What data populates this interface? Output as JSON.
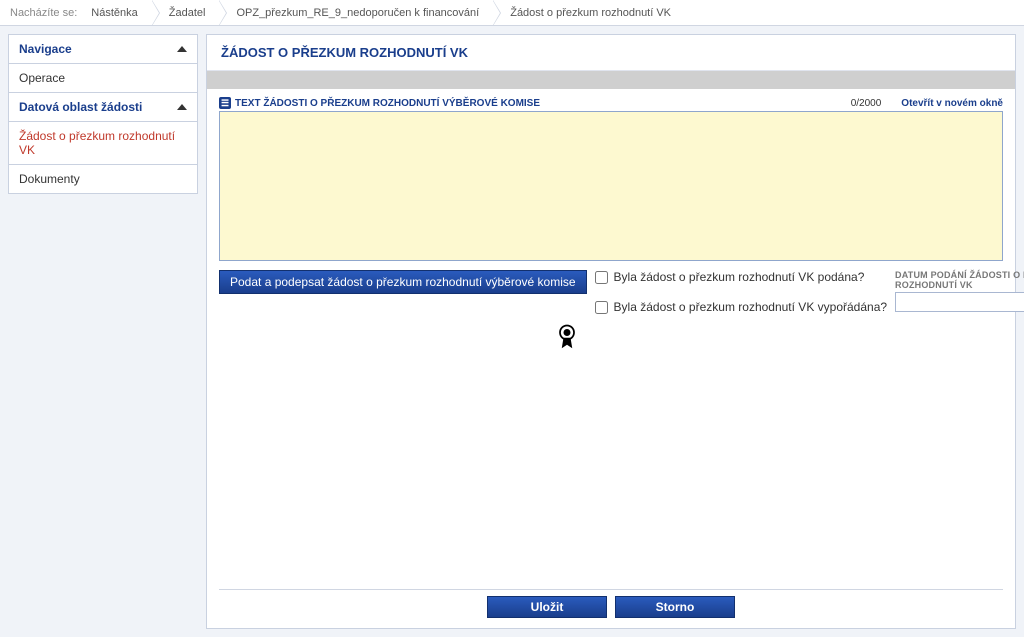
{
  "breadcrumb": {
    "label": "Nacházíte se:",
    "items": [
      "Nástěnka",
      "Žadatel",
      "OPZ_přezkum_RE_9_nedoporučen k financování",
      "Žádost o přezkum rozhodnutí VK"
    ]
  },
  "sidebar": {
    "nav_header": "Navigace",
    "nav_items": [
      "Operace"
    ],
    "data_header": "Datová oblast žádosti",
    "data_items": [
      {
        "label": "Žádost o přezkum rozhodnutí VK",
        "active": true
      },
      {
        "label": "Dokumenty",
        "active": false
      }
    ]
  },
  "main": {
    "title": "ŽÁDOST O PŘEZKUM ROZHODNUTÍ VK",
    "text_field": {
      "label": "TEXT ŽÁDOSTI O PŘEZKUM ROZHODNUTÍ VÝBĚROVÉ KOMISE",
      "counter": "0/2000",
      "open_link": "Otevřít v novém okně",
      "value": ""
    },
    "submit_button": "Podat a podepsat žádost o přezkum rozhodnutí výběrové komise",
    "check1": "Byla žádost o přezkum rozhodnutí VK podána?",
    "check2": "Byla žádost o přezkum rozhodnutí VK vypořádána?",
    "date_label": "DATUM PODÁNÍ ŽÁDOSTI O PŘEZKUM ROZHODNUTÍ VK",
    "date_value": "",
    "footer": {
      "save": "Uložit",
      "cancel": "Storno"
    }
  }
}
